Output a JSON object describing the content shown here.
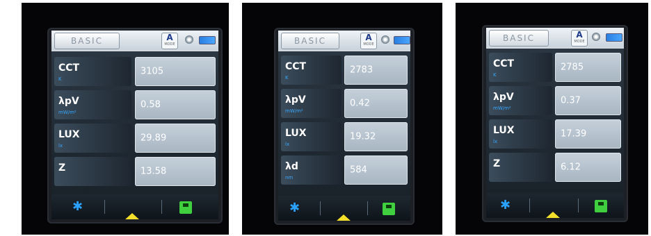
{
  "panels": [
    {
      "tab": "BASIC",
      "mode_letter": "A",
      "mode_sub": "MODE",
      "rows": [
        {
          "name": "CCT",
          "unit": "K",
          "value": "3105"
        },
        {
          "name": "λpV",
          "unit": "mW/m²",
          "value": "0.58"
        },
        {
          "name": "LUX",
          "unit": "lx",
          "value": "29.89"
        },
        {
          "name": "Z",
          "unit": "",
          "value": "13.58"
        }
      ]
    },
    {
      "tab": "BASIC",
      "mode_letter": "A",
      "mode_sub": "MODE",
      "rows": [
        {
          "name": "CCT",
          "unit": "K",
          "value": "2783"
        },
        {
          "name": "λpV",
          "unit": "mW/m²",
          "value": "0.42"
        },
        {
          "name": "LUX",
          "unit": "lx",
          "value": "19.32"
        },
        {
          "name": "λd",
          "unit": "nm",
          "value": "584"
        }
      ]
    },
    {
      "tab": "BASIC",
      "mode_letter": "A",
      "mode_sub": "MODE",
      "rows": [
        {
          "name": "CCT",
          "unit": "K",
          "value": "2785"
        },
        {
          "name": "λpV",
          "unit": "mW/m²",
          "value": "0.37"
        },
        {
          "name": "LUX",
          "unit": "lx",
          "value": "17.39"
        },
        {
          "name": "Z",
          "unit": "",
          "value": "6.12"
        }
      ]
    }
  ],
  "icons": {
    "settings": "gear-icon",
    "home": "home-icon",
    "save": "save-icon",
    "light": "light-sensor-icon",
    "battery": "battery-icon"
  },
  "colors": {
    "unit_text": "#38a8ff",
    "gear": "#2aa0ff",
    "home": "#f4e02a",
    "save": "#3fcf3f",
    "battery": "#2a7fe0"
  }
}
